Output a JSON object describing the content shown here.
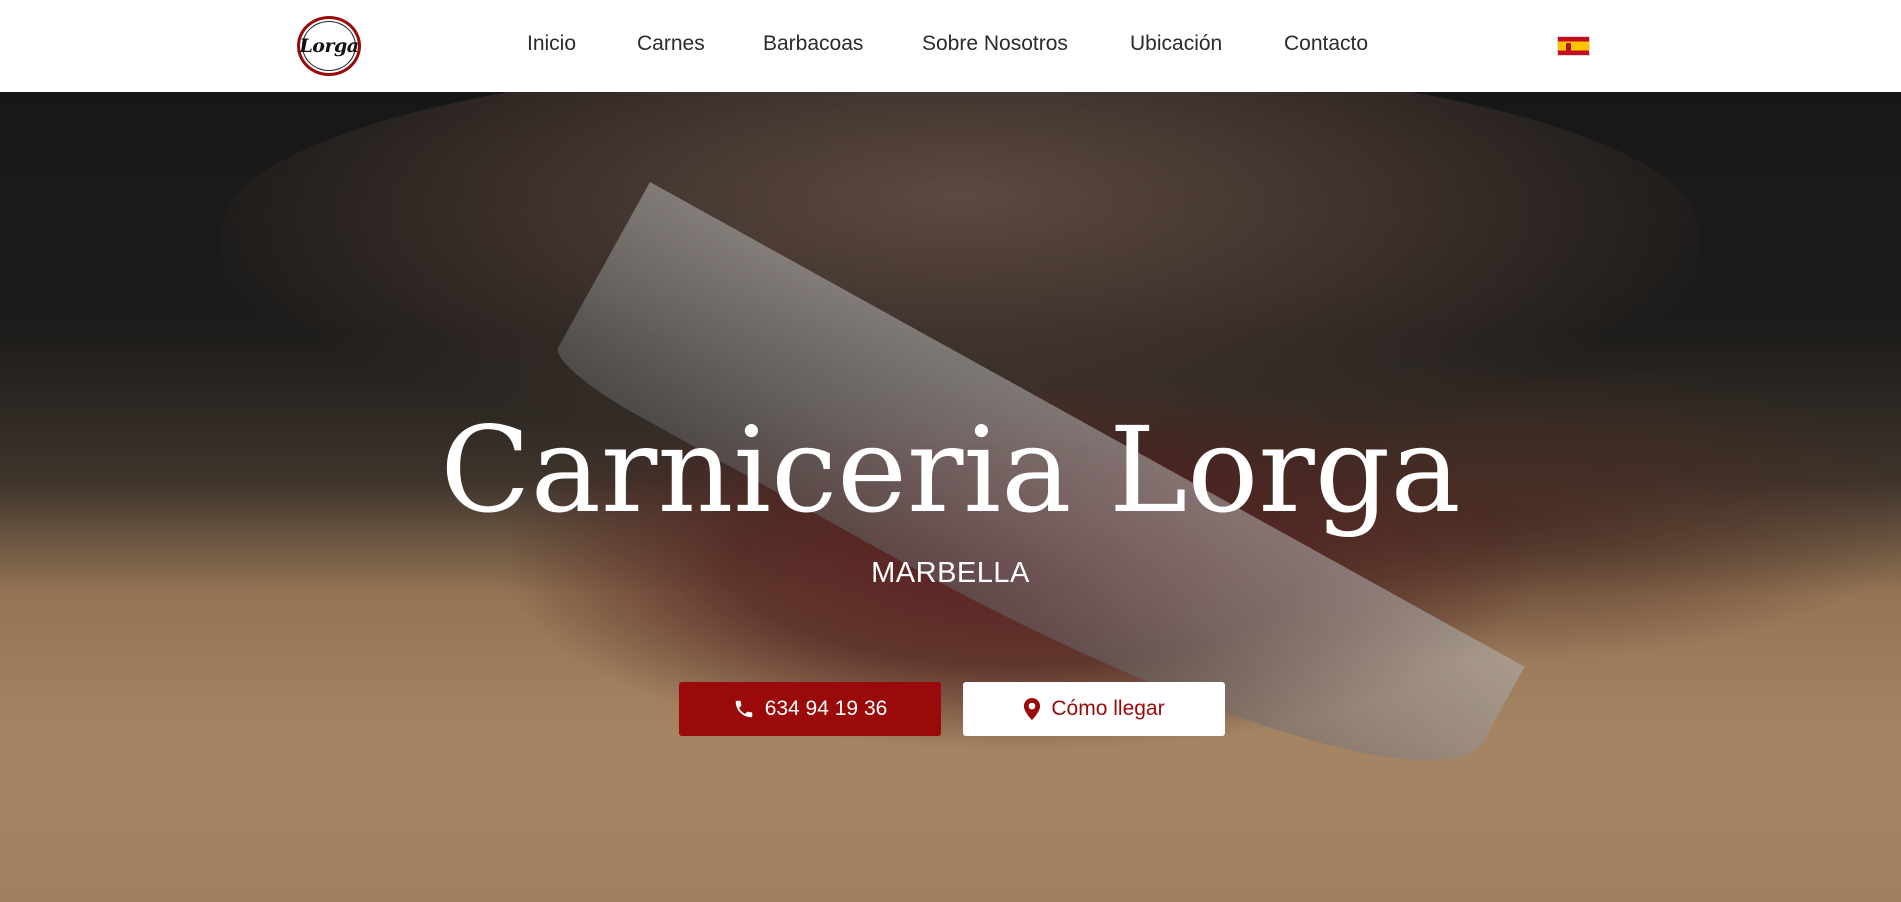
{
  "header": {
    "logo_text": "Lorga",
    "nav": [
      {
        "label": "Inicio"
      },
      {
        "label": "Carnes"
      },
      {
        "label": "Barbacoas"
      },
      {
        "label": "Sobre Nosotros"
      },
      {
        "label": "Ubicación"
      },
      {
        "label": "Contacto"
      }
    ],
    "language_icon": "spain-flag-icon"
  },
  "hero": {
    "title": "Carniceria Lorga",
    "subtitle": "MARBELLA",
    "phone_button": {
      "label": "634 94 19 36",
      "icon": "phone-icon"
    },
    "directions_button": {
      "label": "Cómo llegar",
      "icon": "map-pin-icon"
    }
  },
  "colors": {
    "accent": "#9b0a0a",
    "header_bg": "#ffffff",
    "nav_text": "#2b2b2b",
    "hero_text": "#ffffff"
  }
}
